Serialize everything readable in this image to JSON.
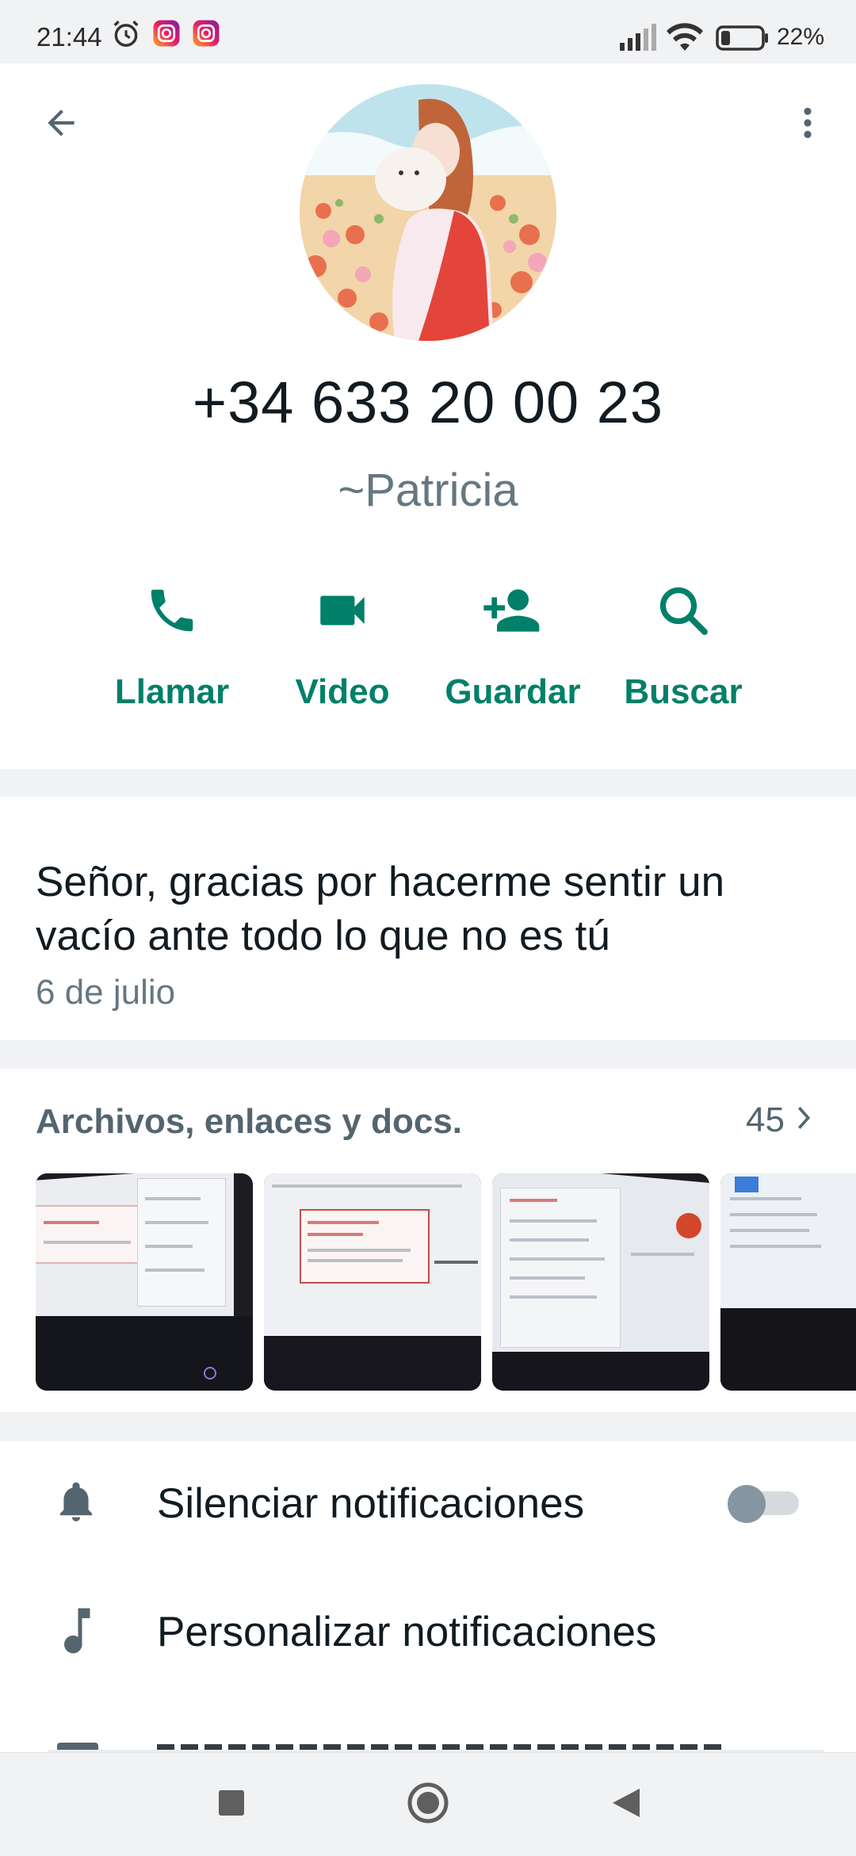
{
  "status_bar": {
    "time": "21:44",
    "battery_percent": "22%",
    "battery_level": 0.22,
    "icons": [
      "alarm-icon",
      "instagram-icon",
      "instagram-icon",
      "signal-icon",
      "wifi-icon",
      "battery-icon"
    ]
  },
  "header": {
    "back_icon": "arrow-back-icon",
    "menu_icon": "more-vert-icon"
  },
  "contact": {
    "phone": "+34 633 20 00 23",
    "push_name": "~Patricia"
  },
  "actions": [
    {
      "label": "Llamar",
      "icon": "phone-icon"
    },
    {
      "label": "Video",
      "icon": "video-icon"
    },
    {
      "label": "Guardar",
      "icon": "add-contact-icon"
    },
    {
      "label": "Buscar",
      "icon": "search-icon"
    }
  ],
  "about": {
    "text": "Señor, gracias por hacerme sentir un vacío ante todo lo que no es tú",
    "date": "6 de julio"
  },
  "media": {
    "title": "Archivos, enlaces y docs.",
    "count": "45",
    "chevron_icon": "chevron-right-icon"
  },
  "settings": [
    {
      "label": "Silenciar notificaciones",
      "icon": "bell-icon",
      "toggle": false
    },
    {
      "label": "Personalizar notificaciones",
      "icon": "music-note-icon"
    }
  ],
  "nav": [
    "recents-icon",
    "home-icon",
    "back-triangle-icon"
  ],
  "colors": {
    "accent": "#008069",
    "background": "#f1f2f4",
    "secondary_text": "#667781"
  }
}
